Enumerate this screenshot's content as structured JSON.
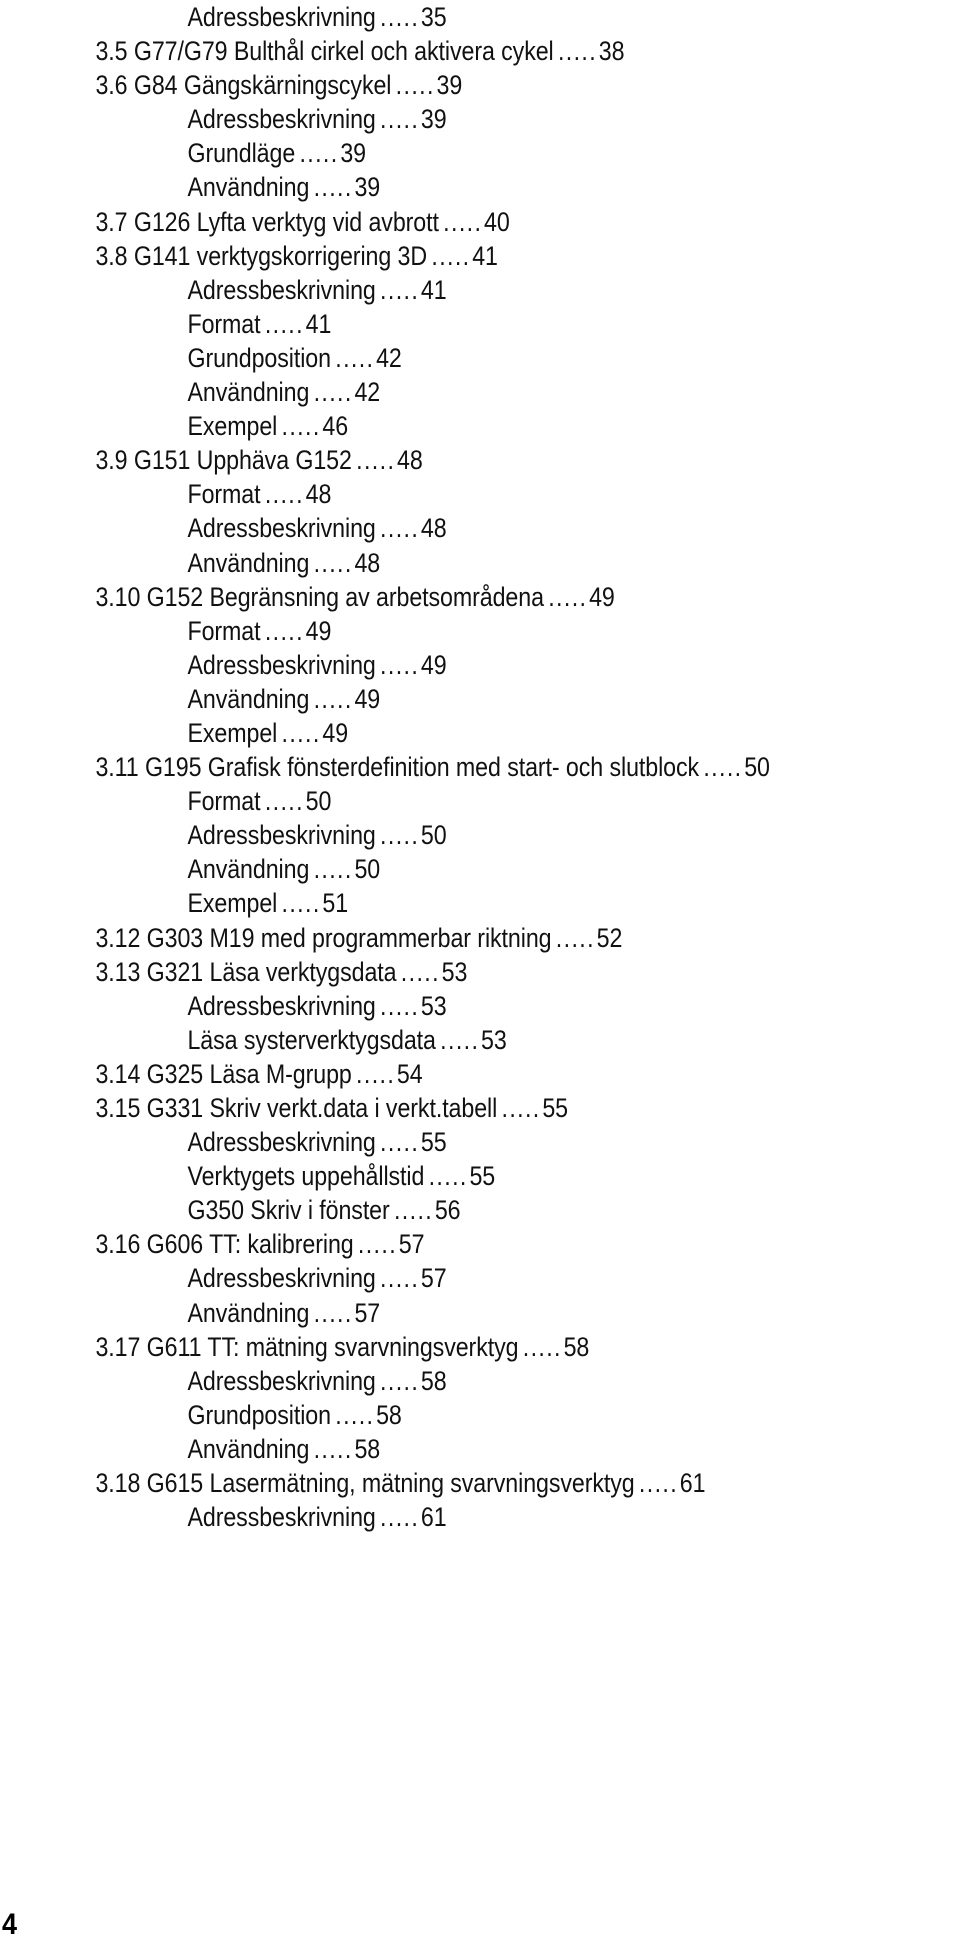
{
  "document": {
    "page_label": "4",
    "leader": "....."
  },
  "toc": {
    "entries": [
      {
        "level": 2,
        "title": "Adressbeskrivning",
        "page": "35"
      },
      {
        "level": 1,
        "title": "3.5 G77/G79 Bulthål cirkel och aktivera cykel",
        "page": "38"
      },
      {
        "level": 1,
        "title": "3.6 G84 Gängskärningscykel",
        "page": "39"
      },
      {
        "level": 2,
        "title": "Adressbeskrivning",
        "page": "39"
      },
      {
        "level": 2,
        "title": "Grundläge",
        "page": "39"
      },
      {
        "level": 2,
        "title": "Användning",
        "page": "39"
      },
      {
        "level": 1,
        "title": "3.7 G126 Lyfta verktyg vid avbrott",
        "page": "40"
      },
      {
        "level": 1,
        "title": "3.8 G141 verktygskorrigering 3D",
        "page": "41"
      },
      {
        "level": 2,
        "title": "Adressbeskrivning",
        "page": "41"
      },
      {
        "level": 2,
        "title": "Format",
        "page": "41"
      },
      {
        "level": 2,
        "title": "Grundposition",
        "page": "42"
      },
      {
        "level": 2,
        "title": "Användning",
        "page": "42"
      },
      {
        "level": 2,
        "title": "Exempel",
        "page": "46"
      },
      {
        "level": 1,
        "title": "3.9 G151 Upphäva G152",
        "page": "48"
      },
      {
        "level": 2,
        "title": "Format",
        "page": "48"
      },
      {
        "level": 2,
        "title": "Adressbeskrivning",
        "page": "48"
      },
      {
        "level": 2,
        "title": "Användning",
        "page": "48"
      },
      {
        "level": 1,
        "title": "3.10 G152 Begränsning av arbetsområdena",
        "page": "49"
      },
      {
        "level": 2,
        "title": "Format",
        "page": "49"
      },
      {
        "level": 2,
        "title": "Adressbeskrivning",
        "page": "49"
      },
      {
        "level": 2,
        "title": "Användning",
        "page": "49"
      },
      {
        "level": 2,
        "title": "Exempel",
        "page": "49"
      },
      {
        "level": 1,
        "title": "3.11 G195 Grafisk fönsterdefinition med start- och slutblock",
        "page": "50"
      },
      {
        "level": 2,
        "title": "Format",
        "page": "50"
      },
      {
        "level": 2,
        "title": "Adressbeskrivning",
        "page": "50"
      },
      {
        "level": 2,
        "title": "Användning",
        "page": "50"
      },
      {
        "level": 2,
        "title": "Exempel",
        "page": "51"
      },
      {
        "level": 1,
        "title": "3.12 G303 M19 med programmerbar riktning",
        "page": "52"
      },
      {
        "level": 1,
        "title": "3.13 G321 Läsa verktygsdata",
        "page": "53"
      },
      {
        "level": 2,
        "title": "Adressbeskrivning",
        "page": "53"
      },
      {
        "level": 2,
        "title": "Läsa systerverktygsdata",
        "page": "53"
      },
      {
        "level": 1,
        "title": "3.14 G325 Läsa M-grupp",
        "page": "54"
      },
      {
        "level": 1,
        "title": "3.15 G331 Skriv verkt.data i verkt.tabell",
        "page": "55"
      },
      {
        "level": 2,
        "title": "Adressbeskrivning",
        "page": "55"
      },
      {
        "level": 2,
        "title": "Verktygets uppehållstid",
        "page": "55"
      },
      {
        "level": 2,
        "title": "G350 Skriv i fönster",
        "page": "56"
      },
      {
        "level": 1,
        "title": "3.16 G606 TT: kalibrering",
        "page": "57"
      },
      {
        "level": 2,
        "title": "Adressbeskrivning",
        "page": "57"
      },
      {
        "level": 2,
        "title": "Användning",
        "page": "57"
      },
      {
        "level": 1,
        "title": "3.17 G611 TT: mätning svarvningsverktyg",
        "page": "58"
      },
      {
        "level": 2,
        "title": "Adressbeskrivning",
        "page": "58"
      },
      {
        "level": 2,
        "title": "Grundposition",
        "page": "58"
      },
      {
        "level": 2,
        "title": "Användning",
        "page": "58"
      },
      {
        "level": 1,
        "title": "3.18 G615 Lasermätning, mätning svarvningsverktyg",
        "page": "61"
      },
      {
        "level": 2,
        "title": "Adressbeskrivning",
        "page": "61"
      }
    ]
  }
}
